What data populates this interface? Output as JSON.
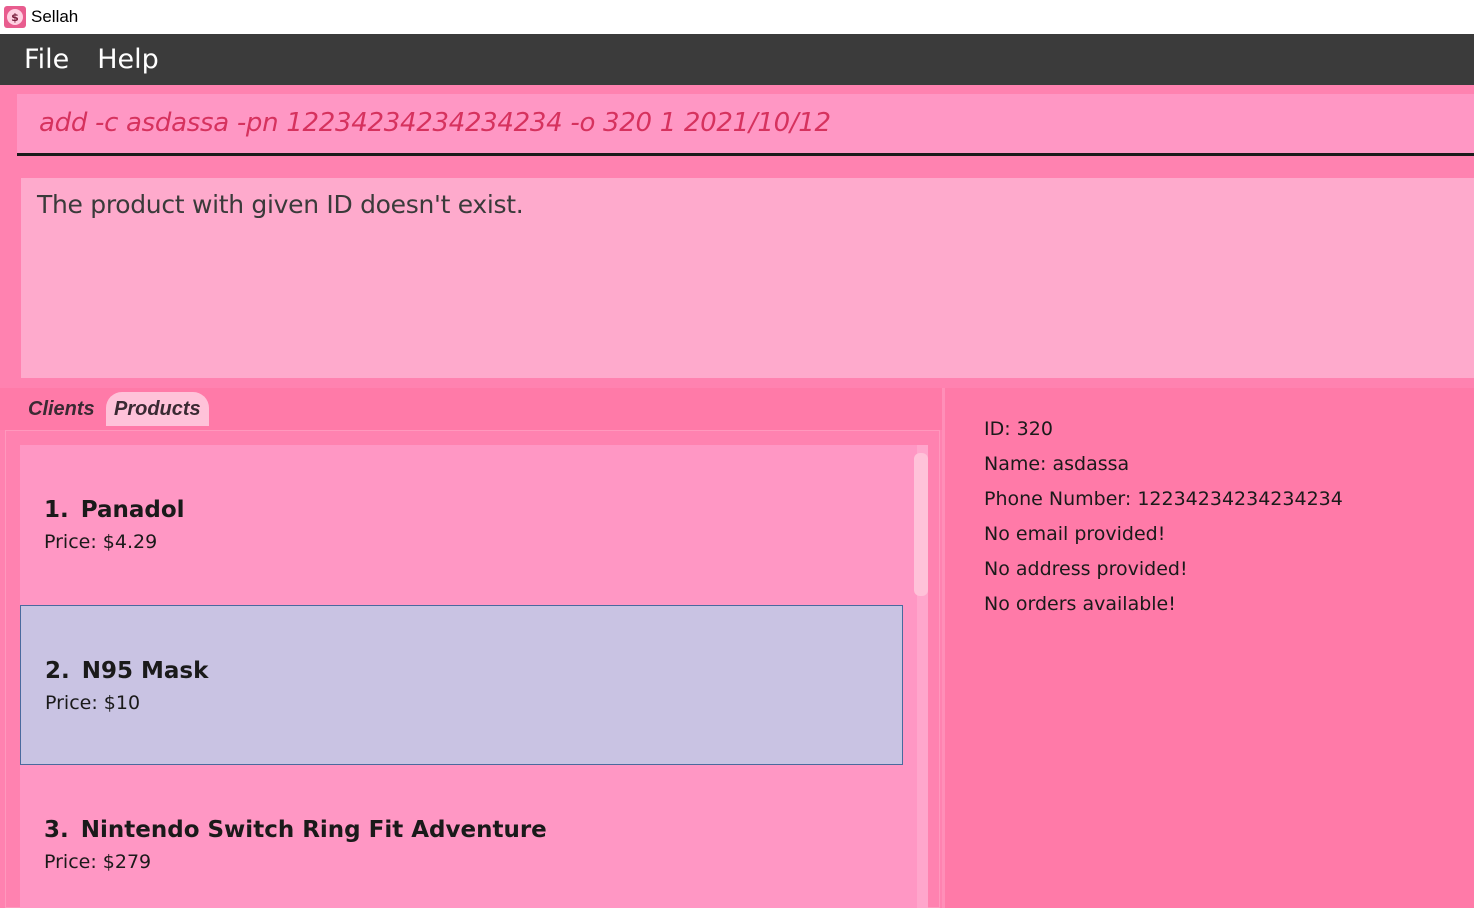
{
  "window": {
    "title": "Sellah",
    "icon": "dollar-coin-icon"
  },
  "menu": {
    "file": "File",
    "help": "Help"
  },
  "command": {
    "value": "add -c asdassa -pn 12234234234234234 -o 320 1 2021/10/12"
  },
  "result": {
    "message": "The product with given ID doesn't exist."
  },
  "tabs": {
    "clients": "Clients",
    "products": "Products",
    "active": "Products"
  },
  "products": [
    {
      "index": "1.",
      "name": "Panadol",
      "price": "Price: $4.29"
    },
    {
      "index": "2.",
      "name": "N95 Mask",
      "price": "Price: $10"
    },
    {
      "index": "3.",
      "name": "Nintendo Switch Ring Fit Adventure",
      "price": "Price: $279"
    }
  ],
  "selected_product": 2,
  "details": {
    "id": "ID: 320",
    "name": "Name: asdassa",
    "phone": "Phone Number: 12234234234234234",
    "email": "No email provided!",
    "address": "No address provided!",
    "orders": "No orders available!"
  },
  "colors": {
    "background": "#ff7aa8",
    "panel": "#ff97c4",
    "result_panel": "#feaacc",
    "selected_card": "#c9c3e3",
    "menubar": "#3b3b3b",
    "command_text": "#d6325e"
  }
}
